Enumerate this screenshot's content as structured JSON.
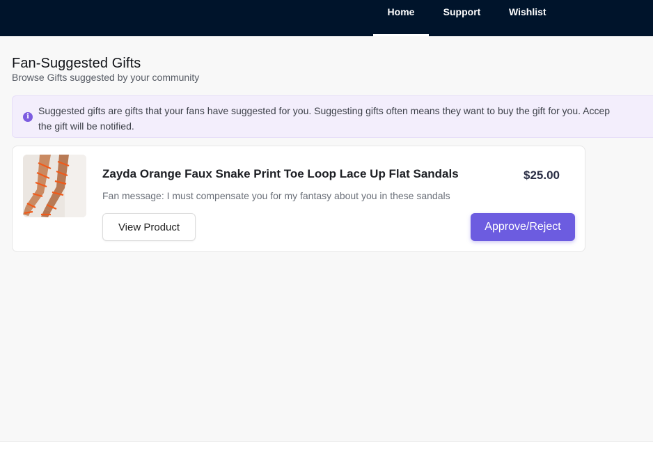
{
  "nav": {
    "items": [
      {
        "label": "Home",
        "active": true
      },
      {
        "label": "Support",
        "active": false
      },
      {
        "label": "Wishlist",
        "active": false
      }
    ]
  },
  "header": {
    "title": "Fan-Suggested Gifts",
    "subtitle": "Browse Gifts suggested by your community"
  },
  "notice": {
    "icon": "info-icon",
    "line1": "Suggested gifts are gifts that your fans have suggested for you. Suggesting gifts often means they want to buy the gift for you. Accep",
    "line2": "the gift will be notified."
  },
  "gifts": [
    {
      "name": "Zayda Orange Faux Snake Print Toe Loop Lace Up Flat Sandals",
      "price": "$25.00",
      "fan_message": "Fan message: I must compensate you for my fantasy about you in these sandals",
      "view_label": "View Product",
      "approve_label": "Approve/Reject"
    }
  ],
  "colors": {
    "topbar": "#00142b",
    "accent": "#6c5ce0",
    "notice_bg": "#f3eefc",
    "page_bg": "#f8f8f8"
  }
}
